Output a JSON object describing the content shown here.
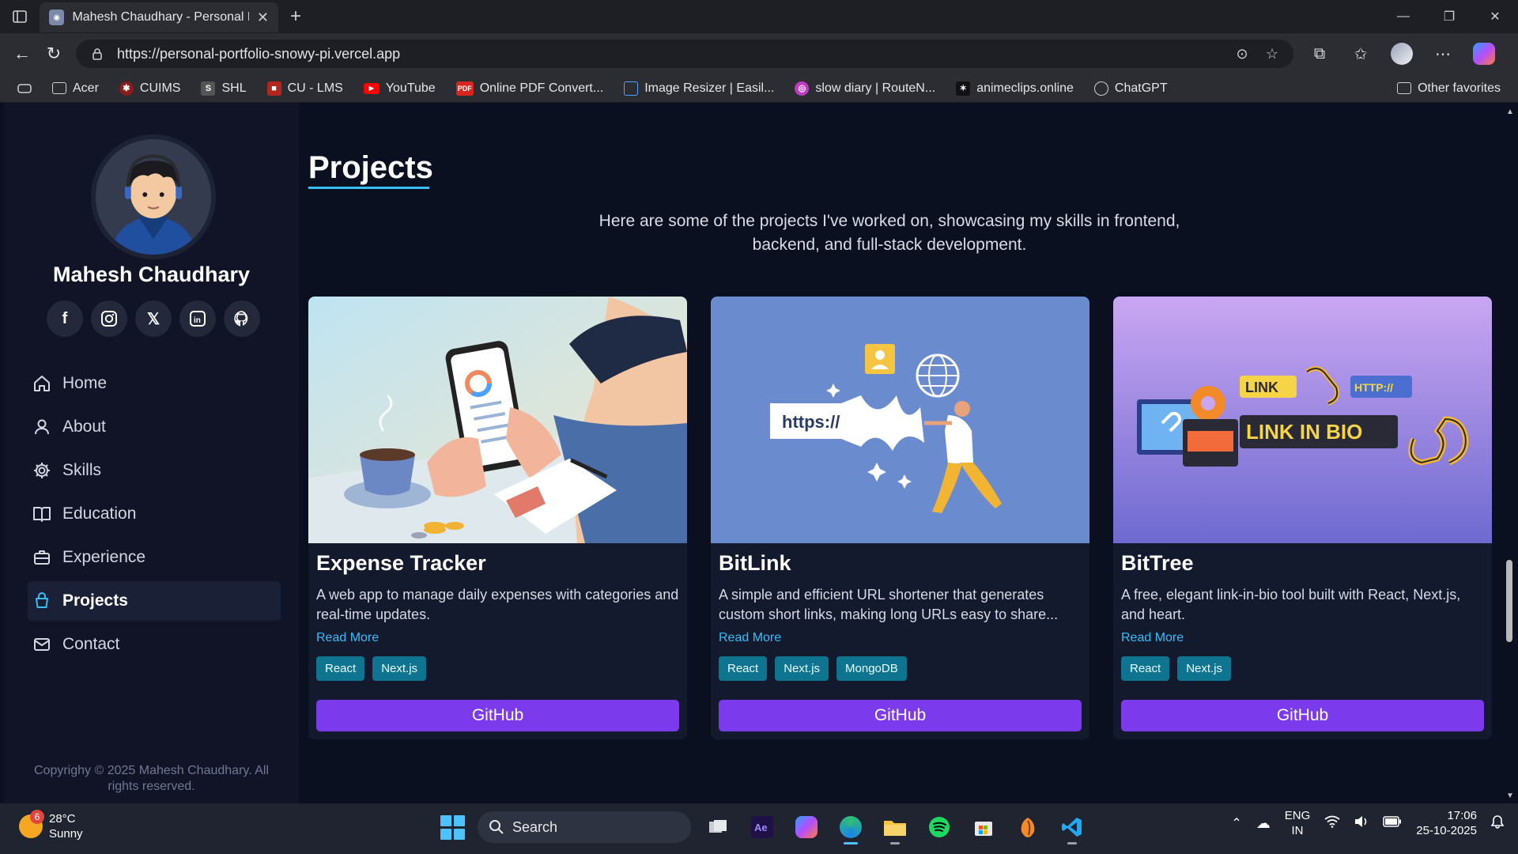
{
  "browser": {
    "tab_title": "Mahesh Chaudhary - Personal Por",
    "url": "https://personal-portfolio-snowy-pi.vercel.app",
    "bookmarks": [
      {
        "label": "Acer",
        "icon": "folder-icon"
      },
      {
        "label": "CUIMS",
        "icon": "cuims-icon"
      },
      {
        "label": "SHL",
        "icon": "shl-icon"
      },
      {
        "label": "CU - LMS",
        "icon": "lms-icon"
      },
      {
        "label": "YouTube",
        "icon": "youtube-icon"
      },
      {
        "label": "Online PDF Convert...",
        "icon": "pdf-icon"
      },
      {
        "label": "Image Resizer | Easil...",
        "icon": "image-resizer-icon"
      },
      {
        "label": "slow diary | RouteN...",
        "icon": "routenote-icon"
      },
      {
        "label": "animeclips.online",
        "icon": "animeclips-icon"
      },
      {
        "label": "ChatGPT",
        "icon": "chatgpt-icon"
      }
    ],
    "other_favorites": "Other favorites"
  },
  "sidebar": {
    "name": "Mahesh Chaudhary",
    "socials": [
      "facebook-icon",
      "instagram-icon",
      "x-icon",
      "linkedin-icon",
      "github-icon"
    ],
    "menu": [
      {
        "label": "Home",
        "icon": "home-icon"
      },
      {
        "label": "About",
        "icon": "user-icon"
      },
      {
        "label": "Skills",
        "icon": "gear-icon"
      },
      {
        "label": "Education",
        "icon": "book-icon"
      },
      {
        "label": "Experience",
        "icon": "briefcase-icon"
      },
      {
        "label": "Projects",
        "icon": "projects-icon",
        "active": true
      },
      {
        "label": "Contact",
        "icon": "mail-icon"
      }
    ],
    "copyright": "Copyrighy © 2025 Mahesh Chaudhary. All rights reserved."
  },
  "main": {
    "title": "Projects",
    "intro": "Here are some of the projects I've worked on, showcasing my skills in frontend, backend, and full-stack development.",
    "projects": [
      {
        "title": "Expense Tracker",
        "description": "A web app to manage daily expenses with categories and real-time updates.",
        "read_more": "Read More",
        "tags": [
          "React",
          "Next.js"
        ],
        "button": "GitHub"
      },
      {
        "title": "BitLink",
        "description": "A simple and efficient URL shortener that generates custom short links, making long URLs easy to share...",
        "read_more": "Read More",
        "tags": [
          "React",
          "Next.js",
          "MongoDB"
        ],
        "button": "GitHub",
        "image_text": "https://"
      },
      {
        "title": "BitTree",
        "description": "A free, elegant link-in-bio tool built with React, Next.js, and heart.",
        "read_more": "Read More",
        "tags": [
          "React",
          "Next.js"
        ],
        "button": "GitHub",
        "image_text": "LINK IN BIO",
        "image_link": "LINK",
        "image_http": "HTTP://"
      }
    ]
  },
  "taskbar": {
    "weather_temp": "28°C",
    "weather_desc": "Sunny",
    "weather_badge": "6",
    "search": "Search",
    "lang_1": "ENG",
    "lang_2": "IN",
    "time": "17:06",
    "date": "25-10-2025"
  },
  "colors": {
    "accent_purple": "#7c3aed",
    "tag_teal": "#0e7490",
    "link_blue": "#38bdf8",
    "page_bg": "#0b1020"
  }
}
